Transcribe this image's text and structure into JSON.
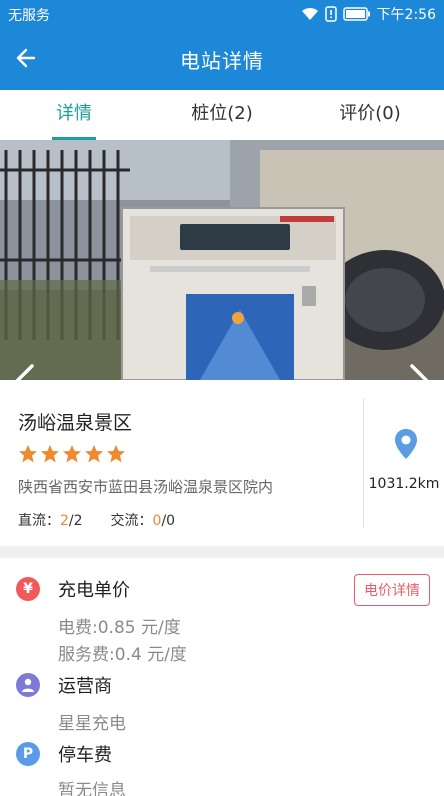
{
  "status_bar": {
    "carrier": "无服务",
    "time": "下午2:56",
    "icons": [
      "wifi-icon",
      "alert-sim-icon",
      "battery-icon"
    ]
  },
  "nav": {
    "title": "电站详情",
    "back_icon": "arrow-left-icon"
  },
  "tabs": [
    {
      "label": "详情",
      "active": true
    },
    {
      "label": "桩位(2)",
      "active": false
    },
    {
      "label": "评价(0)",
      "active": false
    }
  ],
  "carousel": {
    "dot_count": 2,
    "active_dot": 2
  },
  "station": {
    "name": "汤峪温泉景区",
    "rating": 5,
    "address": "陕西省西安市蓝田县汤峪温泉景区院内",
    "dc_label": "直流：",
    "dc_available": "2",
    "dc_total": "/2",
    "ac_label": "交流：",
    "ac_available": "0",
    "ac_total": "/0",
    "distance": "1031.2km"
  },
  "details": {
    "price": {
      "title": "充电单价",
      "electricity_fee": "电费:0.85 元/度",
      "service_fee": "服务费:0.4 元/度",
      "button_label": "电价详情",
      "icon_glyph": "¥"
    },
    "operator": {
      "title": "运营商",
      "value": "星星充电"
    },
    "parking": {
      "title": "停车费",
      "value": "暂无信息",
      "icon_glyph": "P"
    }
  },
  "colors": {
    "primary": "#1e88d8",
    "tab_active": "#1aa09a",
    "star": "#f08a30",
    "price_icon": "#f05a5a",
    "operator_icon": "#7e7ad8",
    "parking_icon": "#5a9ae8",
    "price_button": "#e85d6a",
    "pin": "#5b9de0"
  }
}
